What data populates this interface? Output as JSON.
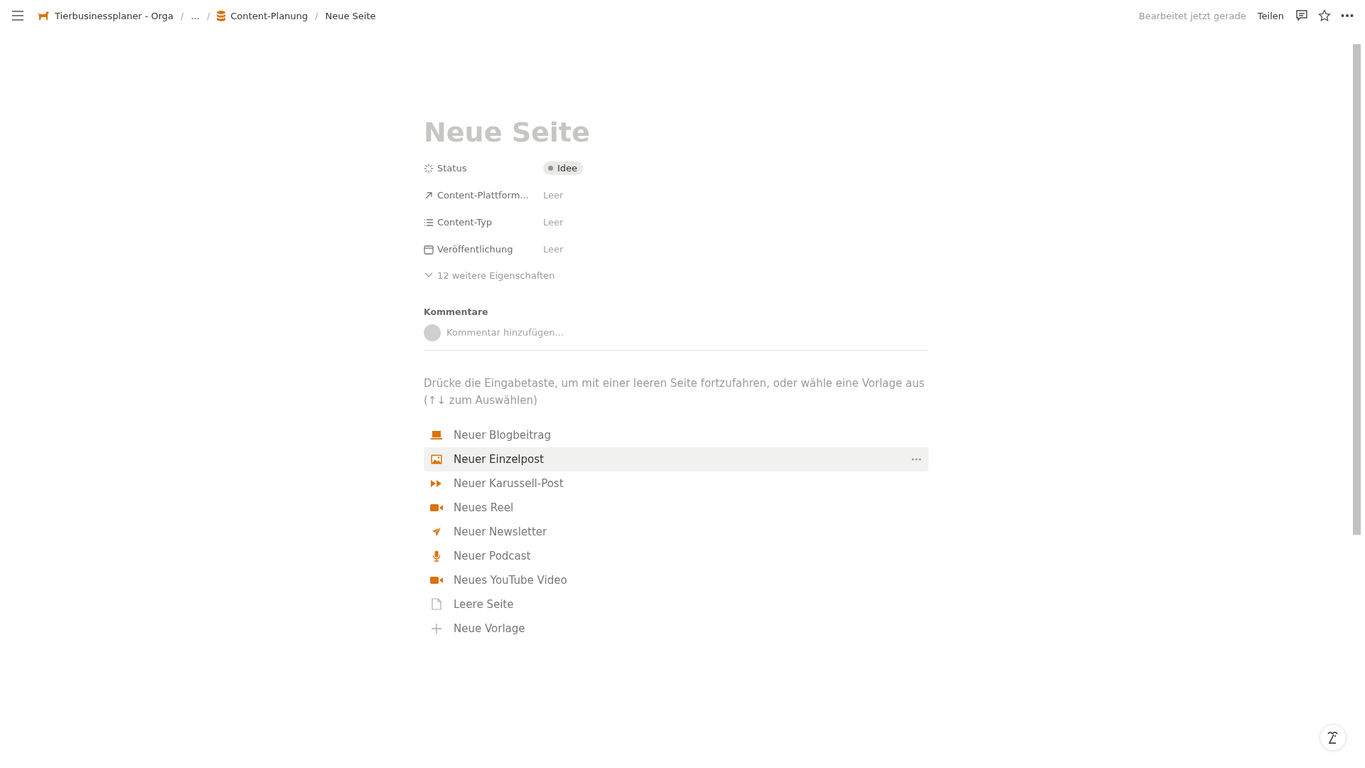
{
  "breadcrumbs": [
    {
      "label": "Tierbusinessplaner - Orga",
      "kind": "dog"
    },
    {
      "separator": "/",
      "label": "...",
      "kind": "plain"
    },
    {
      "separator": "/",
      "label": "Content-Planung",
      "kind": "database"
    },
    {
      "separator": "/",
      "label": "Neue Seite",
      "kind": "plain"
    }
  ],
  "topbar": {
    "edited": "Bearbeitet jetzt gerade",
    "share": "Teilen"
  },
  "page": {
    "title_placeholder": "Neue Seite"
  },
  "properties": [
    {
      "kind": "status",
      "name": "Status",
      "value": "Idee",
      "color": "#91918e"
    },
    {
      "kind": "relation",
      "name": "Content-Plattform...",
      "value": "Leer"
    },
    {
      "kind": "list",
      "name": "Content-Typ",
      "value": "Leer"
    },
    {
      "kind": "date",
      "name": "Veröffentlichung",
      "value": "Leer"
    }
  ],
  "more_properties": "12 weitere Eigenschaften",
  "comments": {
    "heading": "Kommentare",
    "placeholder": "Kommentar hinzufügen..."
  },
  "hint": "Drücke die Eingabetaste, um mit einer leeren Seite fortzufahren, oder wähle eine Vorlage aus (↑↓ zum Auswählen)",
  "templates": [
    {
      "label": "Neuer Blogbeitrag",
      "kind": "laptop",
      "selected": false
    },
    {
      "label": "Neuer Einzelpost",
      "kind": "image",
      "selected": true
    },
    {
      "label": "Neuer Karussell-Post",
      "kind": "forward",
      "selected": false
    },
    {
      "label": "Neues Reel",
      "kind": "video",
      "selected": false
    },
    {
      "label": "Neuer Newsletter",
      "kind": "send",
      "selected": false
    },
    {
      "label": "Neuer Podcast",
      "kind": "mic",
      "selected": false
    },
    {
      "label": "Neues YouTube Video",
      "kind": "video",
      "selected": false
    },
    {
      "label": "Leere Seite",
      "kind": "page",
      "selected": false
    },
    {
      "label": "Neue Vorlage",
      "kind": "add",
      "selected": false
    }
  ]
}
